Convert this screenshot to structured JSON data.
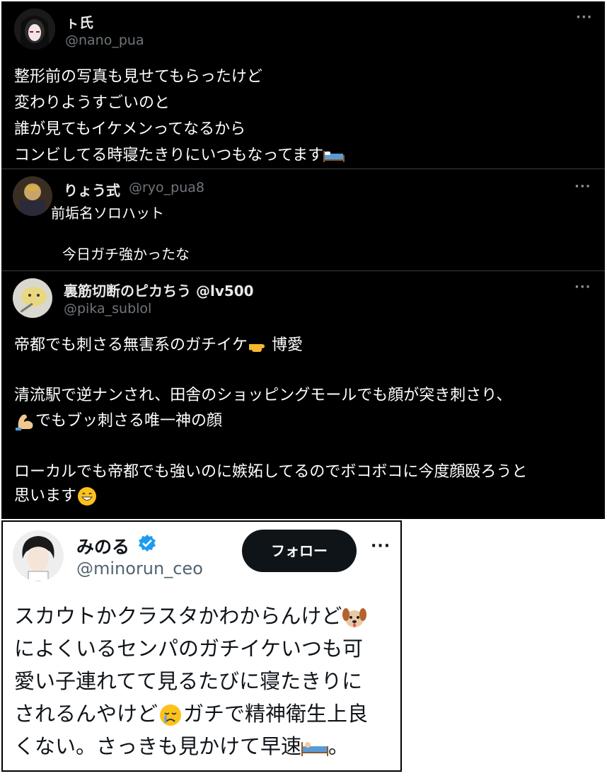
{
  "tweets": [
    {
      "name": "ㇳ氏",
      "handle": "@nano_pua",
      "more": "···",
      "lines": [
        "整形前の写真も見せてもらったけど",
        "変わりようすごいのと",
        "誰が見てもイケメンってなるから",
        "コンビしてる時寝たきりにいつもなってます"
      ],
      "emoji_end": "bed-icon"
    },
    {
      "name": "りょう式",
      "handle": "@ryo_pua8",
      "more": "···",
      "lines": [
        "前垢名ソロハット",
        "今日ガチ強かったな"
      ]
    },
    {
      "name": "裏筋切断のピカちう @lv500",
      "handle": "@pika_sublol",
      "more": "···",
      "lines": [
        "帝都でも刺さる無害系のガチイケ",
        "博愛",
        "清流駅で逆ナンされ、田舎のショッピングモールでも顔が突き刺さり、",
        "でもブッ刺さる唯一神の顔",
        "ローカルでも帝都でも強いのに嫉妬してるのでボコボコに今度顔殴ろうと",
        "思います"
      ]
    }
  ],
  "card": {
    "name": "みのる",
    "handle": "@minorun_ceo",
    "follow_label": "フォロー",
    "more": "···",
    "verified_color": "#1d9bf0",
    "lines": [
      "スカウトかクラスタかわからんけど",
      "によくいるセンパのガチイケいつも可",
      "愛い子連れてて見るたびに寝たきりに",
      "されるんやけど",
      "ガチで精神衛生上良",
      "くない。さっきも見かけて早速",
      "。"
    ]
  }
}
